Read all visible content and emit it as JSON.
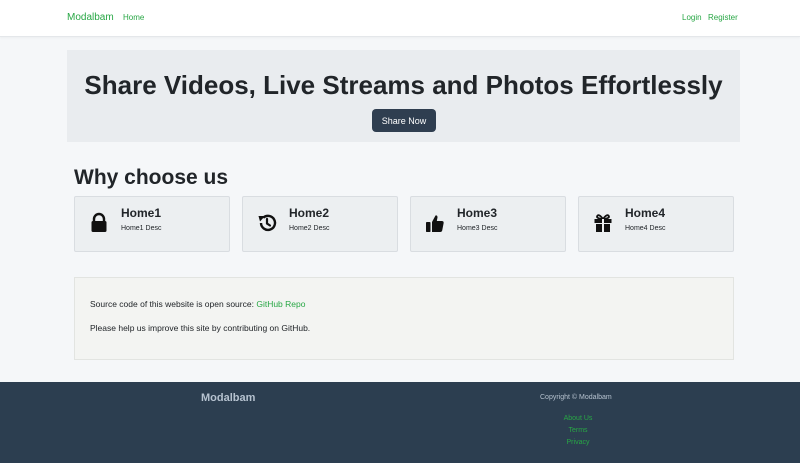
{
  "navbar": {
    "brand": "Modalbam",
    "home": "Home",
    "login": "Login",
    "register": "Register"
  },
  "hero": {
    "title": "Share Videos, Live Streams and Photos Effortlessly",
    "button": "Share Now"
  },
  "features": {
    "title": "Why choose us",
    "items": [
      {
        "title": "Home1",
        "desc": "Home1 Desc",
        "icon": "lock-icon"
      },
      {
        "title": "Home2",
        "desc": "Home2 Desc",
        "icon": "history-icon"
      },
      {
        "title": "Home3",
        "desc": "Home3 Desc",
        "icon": "thumbs-up-icon"
      },
      {
        "title": "Home4",
        "desc": "Home4 Desc",
        "icon": "gift-icon"
      }
    ]
  },
  "info": {
    "line1_prefix": "Source code of this website is open source: ",
    "link": "GitHub Repo",
    "line2": "Please help us improve this site by contributing on GitHub."
  },
  "footer": {
    "brand": "Modalbam",
    "copyright": "Copyright © Modalbam",
    "links": [
      "About Us",
      "Terms",
      "Privacy"
    ]
  },
  "colors": {
    "accent": "#28a745",
    "footer_bg": "#2c3e50",
    "button_bg": "#2f3e50"
  }
}
